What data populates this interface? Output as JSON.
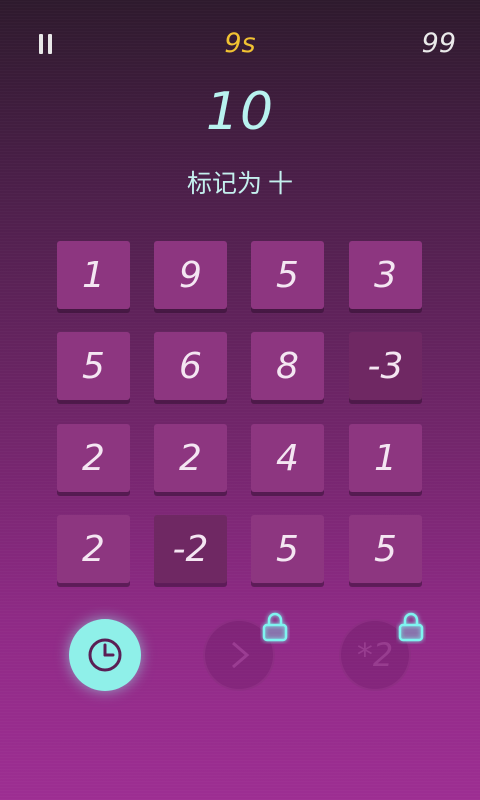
{
  "hud": {
    "timer": "9s",
    "score": "99"
  },
  "puzzle": {
    "target": "10",
    "instruction": "标记为",
    "operator": "十"
  },
  "grid": {
    "rows": [
      [
        "1",
        "9",
        "5",
        "3"
      ],
      [
        "5",
        "6",
        "8",
        "-3"
      ],
      [
        "2",
        "2",
        "4",
        "1"
      ],
      [
        "2",
        "-2",
        "5",
        "5"
      ]
    ]
  },
  "abilities": {
    "double_label": "*2"
  },
  "icons": {
    "pause": "pause-icon",
    "clock": "clock-icon",
    "skip": "chevron-right-icon",
    "lock": "lock-icon"
  },
  "colors": {
    "timer": "#f1c232",
    "target": "#b8f2ef",
    "tile_light": "#8d3680",
    "tile_dark": "#6f2863",
    "clock_ability": "#8ff0e9",
    "lock_glow": "#7ff4f0"
  }
}
